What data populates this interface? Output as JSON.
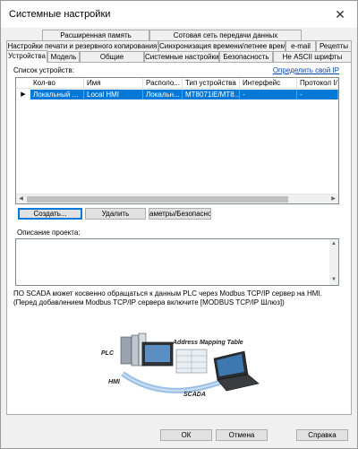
{
  "window": {
    "title": "Системные настройки",
    "close_glyph": "✕"
  },
  "tabs": {
    "row1": [
      "Расширенная память",
      "Сотовая сеть передачи данных"
    ],
    "row2": [
      "Настройки печати и резервного копирования",
      "Синхронизация времени/летнее время",
      "e-mail",
      "Рецепты"
    ],
    "row3": [
      "Устройства",
      "Модель",
      "Общие",
      "Системные настройки",
      "Безопасность",
      "Не ASCII шрифты"
    ],
    "active": "Устройства"
  },
  "devices": {
    "list_label": "Список устройств:",
    "own_ip_link": "Определить свой IP",
    "columns": [
      "Кол-во",
      "Имя",
      "Располо...",
      "Тип устройства",
      "Интерфейс",
      "Протокол I/E"
    ],
    "rows": [
      {
        "marker": "▶",
        "count": "Локальный ...",
        "name": "Local HMI",
        "location": "Локальн...",
        "type": "MT8071iE/MT8...",
        "interface": "-",
        "protocol": "-"
      }
    ]
  },
  "buttons": {
    "create": "Создать...",
    "delete": "Удалить",
    "params": "аметры/Безопасност"
  },
  "project": {
    "desc_label": "Описание проекта:"
  },
  "note": "ПО SCADA может косвенно обращаться к данным PLC через Modbus TCP/IP сервер на HMI. (Перед добавлением Modbus TCP/IP сервера включите [MODBUS TCP/IP Шлюз])",
  "diagram": {
    "labels": {
      "table": "Address Mapping Table",
      "plc": "PLC",
      "hmi": "HMI",
      "scada": "SCADA"
    }
  },
  "footer": {
    "ok": "ОК",
    "cancel": "Отмена",
    "help": "Справка"
  },
  "colors": {
    "selection": "#0078d7",
    "link": "#0645ad",
    "accent": "#0078d7"
  }
}
